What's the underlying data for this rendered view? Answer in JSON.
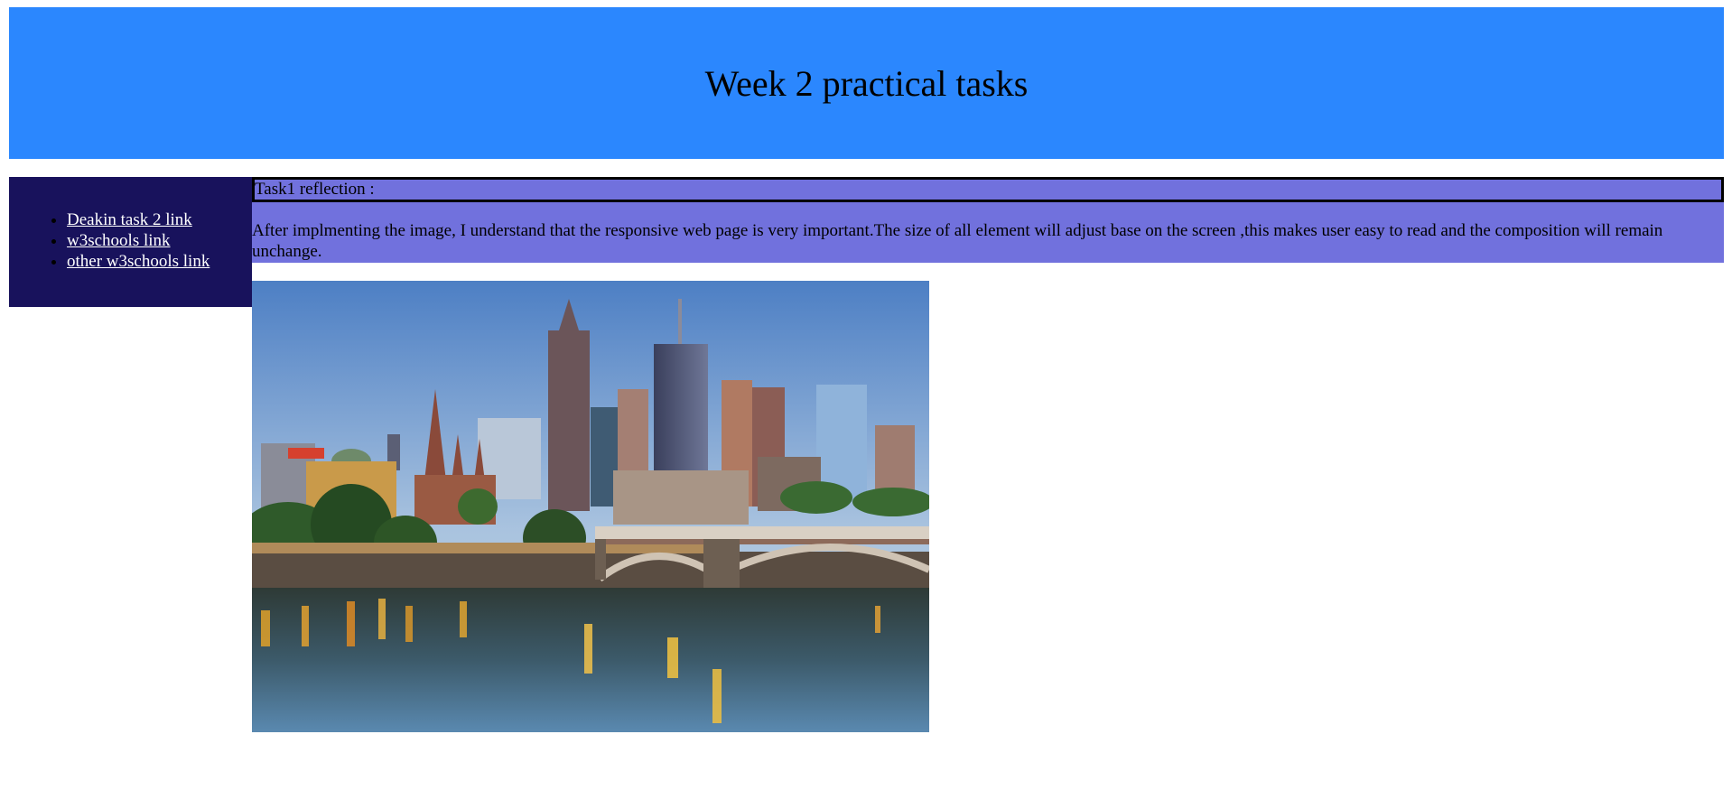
{
  "header": {
    "title": "Week 2 practical tasks",
    "background": "#2b87fe"
  },
  "sidebar": {
    "background": "#18125c",
    "links": [
      {
        "label": "Deakin task 2 link"
      },
      {
        "label": "w3schools link"
      },
      {
        "label": "other w3schools link"
      }
    ]
  },
  "main": {
    "background": "#7171dd",
    "task_title": "Task1 reflection :",
    "task_body": "After implmenting the image, I understand that the responsive web page is very important.The size of all element will adjust base on the screen ,this makes user easy to read and the composition will remain unchange."
  },
  "photo": {
    "subject": "city skyline with river and bridge"
  }
}
